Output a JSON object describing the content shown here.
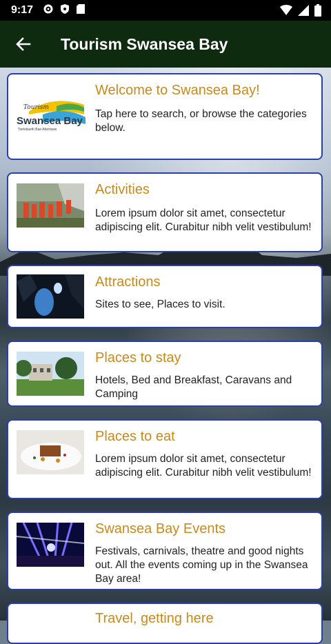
{
  "status": {
    "time": "9:17"
  },
  "app": {
    "title": "Tourism Swansea Bay"
  },
  "cards": [
    {
      "title": "Welcome to Swansea Bay!",
      "desc": "Tap here to search, or browse the categories below.",
      "logo": {
        "script": "Tourism",
        "name": "Swansea Bay",
        "tag": "Twristiaeth Bae Abertawe"
      }
    },
    {
      "title": "Activities",
      "desc": "Lorem ipsum dolor sit amet, consectetur adipiscing elit. Curabitur nibh velit vestibulum!"
    },
    {
      "title": "Attractions",
      "desc": "Sites to see, Places to visit."
    },
    {
      "title": "Places to stay",
      "desc": "Hotels, Bed and Breakfast, Caravans and Camping"
    },
    {
      "title": "Places to eat",
      "desc": "Lorem ipsum dolor sit amet, consectetur adipiscing elit. Curabitur nibh velit vestibulum!"
    },
    {
      "title": "Swansea Bay Events",
      "desc": "Festivals, carnivals, theatre and good nights out.  All the events coming up in the Swansea Bay area!"
    },
    {
      "title": "Travel, getting here"
    }
  ]
}
